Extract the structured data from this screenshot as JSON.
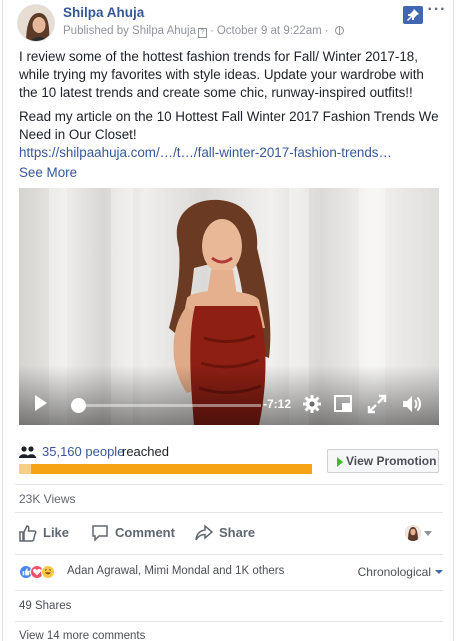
{
  "post": {
    "author": "Shilpa Ahuja",
    "published_by": "Published by Shilpa Ahuja",
    "help_mark": "?",
    "date": "October 9 at 9:22am",
    "more_label": "···",
    "text_1": "I review some of the hottest fashion trends for Fall/ Winter 2017-18, while trying my favorites with style ideas. Update your wardrobe with the 10 latest trends and create some chic, runway-inspired outfits!!",
    "text_2": "Read my article on the 10 Hottest Fall Winter 2017 Fashion Trends We Need in Our Closet!",
    "link": "https://shilpaahuja.com/…/t…/fall-winter-2017-fashion-trends…",
    "see_more": "See More"
  },
  "video": {
    "time_remaining": "-7:12",
    "progress": 0.01
  },
  "reach": {
    "count": "35,160 people",
    "label": "reached",
    "organic_fraction": 0.04,
    "promo_label": "View Promotion"
  },
  "stats": {
    "views": "23K Views"
  },
  "actions": {
    "like": "Like",
    "comment": "Comment",
    "share": "Share"
  },
  "reactions": {
    "names": "Adan Agrawal, Mimi Mondal and 1K others",
    "order": "Chronological"
  },
  "footer": {
    "shares": "49 Shares",
    "more_comments": "View 14 more comments"
  },
  "colors": {
    "link": "#365899",
    "reach_bar": "#f7a414",
    "reach_organic": "#f5cf87",
    "pin": "#4267b2"
  }
}
